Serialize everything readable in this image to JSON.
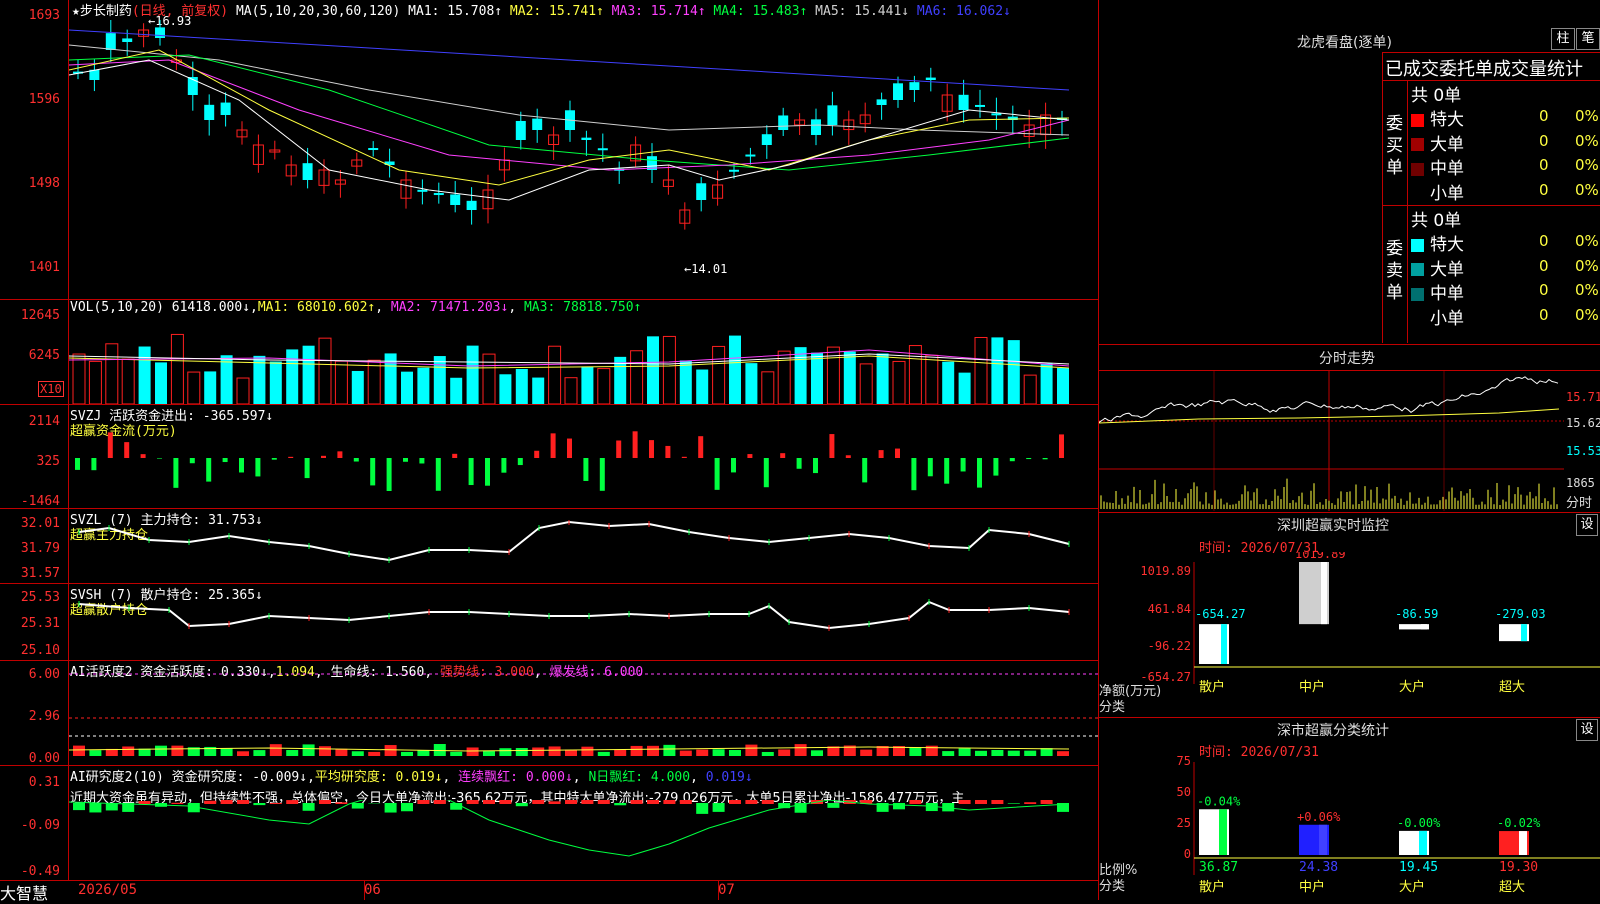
{
  "stock": {
    "name": "★步长制药",
    "period": "(日线, 前复权)",
    "ma_label": "MA(5,10,20,30,60,120)",
    "ma": [
      {
        "label": "MA1: 15.708↑",
        "color": "#ffffff"
      },
      {
        "label": "MA2: 15.741↑",
        "color": "#ffff40"
      },
      {
        "label": "MA3: 15.714↑",
        "color": "#ff40ff"
      },
      {
        "label": "MA4: 15.483↑",
        "color": "#00ff40"
      },
      {
        "label": "MA5: 15.441↓",
        "color": "#cfcfcf"
      },
      {
        "label": "MA6: 16.062↓",
        "color": "#4040ff"
      }
    ],
    "high_mark": "16.93",
    "low_mark": "←14.01",
    "y_ticks": [
      "1693",
      "1596",
      "1498",
      "1401"
    ]
  },
  "vol": {
    "header": "VOL(5,10,20)",
    "value": "61418.000↓",
    "ma1": "MA1: 68010.602↑",
    "ma2": "MA2: 71471.203↓",
    "ma3": "MA3: 78818.750↑",
    "y_ticks": [
      "12645",
      "6245"
    ],
    "unit": "X10"
  },
  "svzj": {
    "header": "SVZJ  活跃资金进出: -365.597↓",
    "sub": "超赢资金流(万元)",
    "y_ticks": [
      "2114",
      "325",
      "-1464"
    ]
  },
  "svzl": {
    "header": "SVZL (7) 主力持仓: 31.753↓",
    "sub": "超赢主力持仓",
    "y_ticks": [
      "32.01",
      "31.79",
      "31.57"
    ]
  },
  "svsh": {
    "header": "SVSH (7) 散户持仓: 25.365↓",
    "sub": "超赢散户持仓",
    "y_ticks": [
      "25.53",
      "25.31",
      "25.10"
    ]
  },
  "ai_active": {
    "header_a": "AI活跃度2 资金活跃度: 0.330↓",
    "header_b": "1.094",
    "header_c": "生命线: 1.560",
    "header_d": "强势线: 3.000",
    "header_e": "爆发线: 6.000",
    "y_ticks": [
      "6.00",
      "2.96",
      "0.00"
    ]
  },
  "ai_research": {
    "header_a": "AI研究度2(10) 资金研究度: -0.009↓",
    "header_b": "平均研究度: 0.019↓",
    "header_c": "连续飘红: 0.000↓",
    "header_d": "N日飘红: 4.000",
    "header_e": "0.019↓",
    "comment": "近期大资金虽有异动，但持续性不强，总体偏空，今日大单净流出:-365.62万元，其中特大单净流出:-279.026万元，大单5日累计净出-1586.477万元，主",
    "y_ticks": [
      "0.31",
      "-0.09",
      "-0.49"
    ]
  },
  "bottom": {
    "brand": "大智慧",
    "dates": [
      "2026/05",
      "06",
      "07"
    ]
  },
  "dragon": {
    "title": "龙虎看盘(逐单)",
    "btn_bar": "柱",
    "btn_pen": "笔",
    "stats_title": "已成交委托单成交量统计",
    "buy_label": "委买单",
    "sell_label": "委卖单",
    "buy_total": "共 0单",
    "sell_total": "共 0单",
    "buy_rows": [
      {
        "name": "特大",
        "count": "0",
        "pct": "0%",
        "color": "#ff0000"
      },
      {
        "name": "大单",
        "count": "0",
        "pct": "0%",
        "color": "#a00000"
      },
      {
        "name": "中单",
        "count": "0",
        "pct": "0%",
        "color": "#700000"
      },
      {
        "name": "小单",
        "count": "0",
        "pct": "0%",
        "color": ""
      }
    ],
    "sell_rows": [
      {
        "name": "特大",
        "count": "0",
        "pct": "0%",
        "color": "#00ffff"
      },
      {
        "name": "大单",
        "count": "0",
        "pct": "0%",
        "color": "#00a0a0"
      },
      {
        "name": "中单",
        "count": "0",
        "pct": "0%",
        "color": "#007070"
      },
      {
        "name": "小单",
        "count": "0",
        "pct": "0%",
        "color": ""
      }
    ]
  },
  "intraday": {
    "title": "分时走势",
    "y_ticks": [
      "15.71",
      "15.62",
      "15.53"
    ],
    "vol_tick": "1865",
    "vol_label": "分时"
  },
  "monitor": {
    "title": "深圳超赢实时监控",
    "btn": "设",
    "time": "时间: 2026/07/31",
    "y_ticks": [
      "1019.89",
      "461.84",
      "-96.22",
      "-654.27"
    ],
    "axis_label_1": "净额(万元)",
    "axis_label_2": "分类",
    "categories": [
      "散户",
      "中户",
      "大户",
      "超大"
    ],
    "values": [
      "-654.27",
      "1019.89",
      "-86.59",
      "-279.03"
    ]
  },
  "classify": {
    "title": "深市超赢分类统计",
    "btn": "设",
    "time": "时间: 2026/07/31",
    "y_ticks": [
      "75",
      "50",
      "25",
      "0"
    ],
    "axis_label_1": "比例%",
    "axis_label_2": "分类",
    "categories": [
      "散户",
      "中户",
      "大户",
      "超大"
    ],
    "changes": [
      "-0.04%",
      "+0.06%",
      "-0.00%",
      "-0.02%"
    ],
    "values": [
      "36.87",
      "24.38",
      "19.45",
      "19.30"
    ]
  },
  "chart_data": [
    {
      "type": "bar",
      "title": "深圳超赢实时监控",
      "categories": [
        "散户",
        "中户",
        "大户",
        "超大"
      ],
      "values": [
        -654.27,
        1019.89,
        -86.59,
        -279.03
      ],
      "ylabel": "净额(万元)",
      "ylim": [
        -654.27,
        1019.89
      ]
    },
    {
      "type": "bar",
      "title": "深市超赢分类统计",
      "categories": [
        "散户",
        "中户",
        "大户",
        "超大"
      ],
      "values": [
        36.87,
        24.38,
        19.45,
        19.3
      ],
      "ylabel": "比例%",
      "ylim": [
        0,
        75
      ]
    }
  ]
}
